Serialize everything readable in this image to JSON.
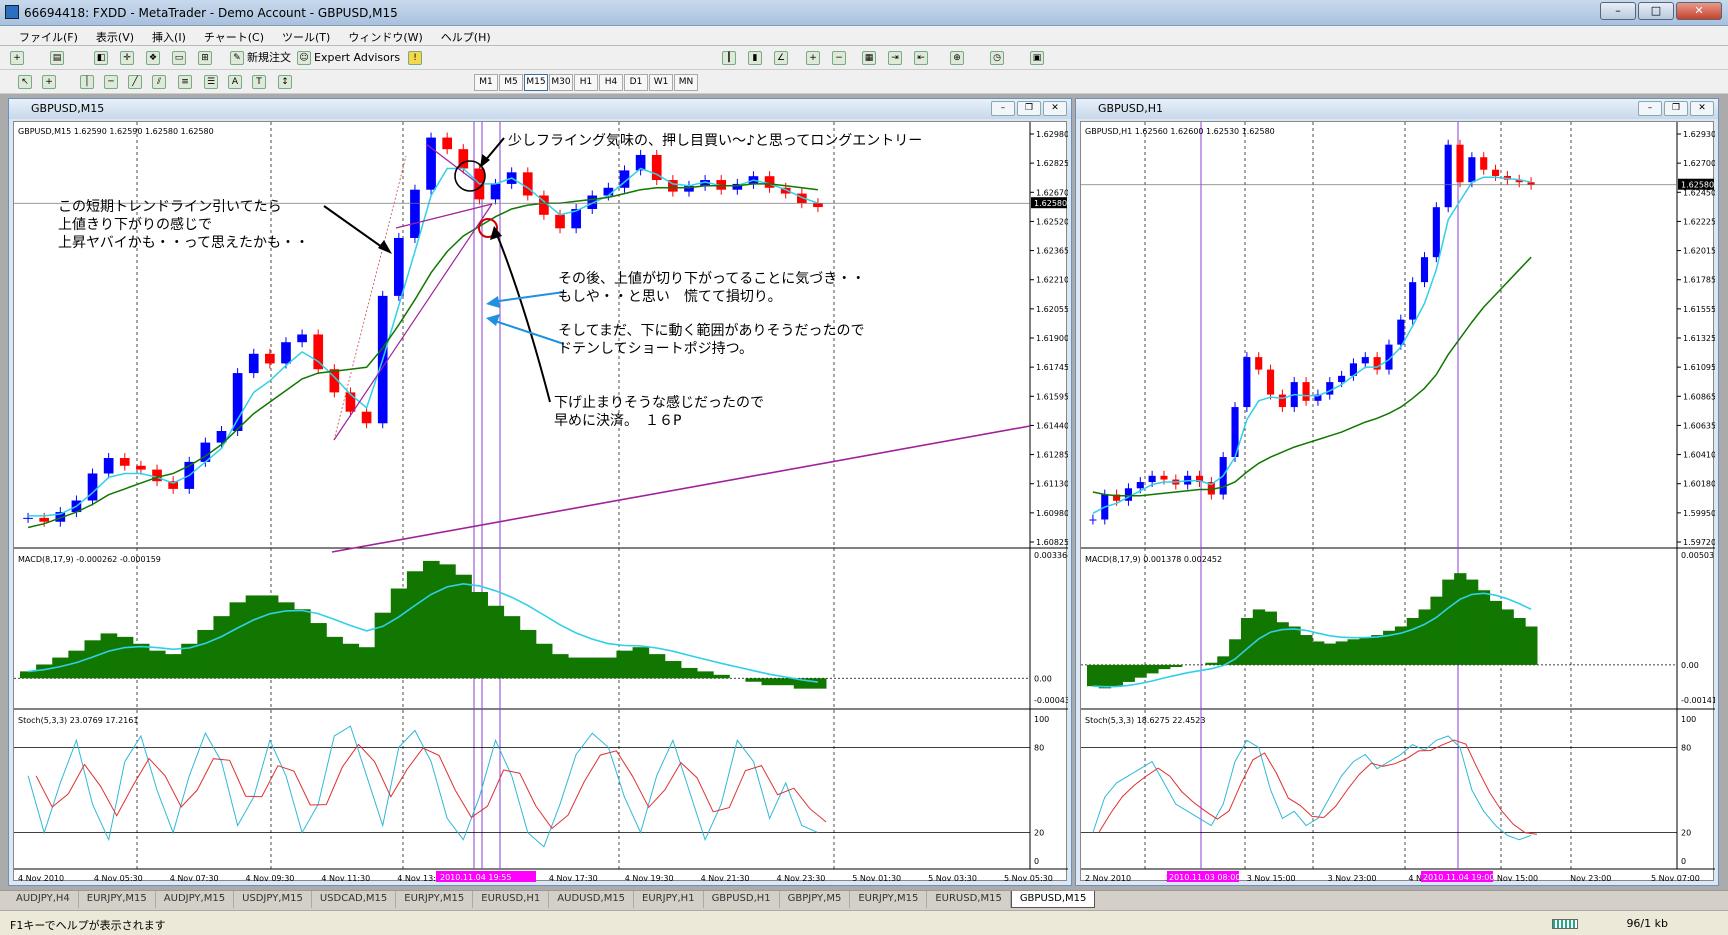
{
  "window": {
    "title": "66694418: FXDD - MetaTrader - Demo Account - GBPUSD,M15"
  },
  "menu": [
    "ファイル(F)",
    "表示(V)",
    "挿入(I)",
    "チャート(C)",
    "ツール(T)",
    "ウィンドウ(W)",
    "ヘルプ(H)"
  ],
  "toolbar": {
    "new_order": "新規注文",
    "expert_advisors": "Expert Advisors"
  },
  "timeframes": [
    "M1",
    "M5",
    "M15",
    "M30",
    "H1",
    "H4",
    "D1",
    "W1",
    "MN"
  ],
  "active_timeframe": "M15",
  "chart_left": {
    "title": "GBPUSD,M15",
    "info": "GBPUSD,M15  1.62590 1.62590 1.62580 1.62580",
    "current_price": "1.62580",
    "macd_label": "MACD(8,17,9) -0.000262 -0.000159",
    "macd_scale": [
      "0.003364",
      "0.00",
      "-0.00043"
    ],
    "stoch_label": "Stoch(5,3,3) 23.0769 17.2161",
    "stoch_scale": [
      "100",
      "80",
      "20",
      "0"
    ],
    "time_marker": "2010.11.04 19:55",
    "annotations": [
      "少しフライング気味の、押し目買い～♪と思ってロングエントリー",
      "この短期トレンドライン引いてたら",
      "上値きり下がりの感じで",
      "上昇ヤバイかも・・って思えたかも・・",
      "その後、上値が切り下がってることに気づき・・",
      "もしや・・と思い　慌てて損切り。",
      "そしてまだ、下に動く範囲がありそうだったので",
      "ドテンしてショートポジ持つ。",
      "下げ止まりそうな感じだったので",
      "早めに決済。　１６P"
    ]
  },
  "chart_right": {
    "title": "GBPUSD,H1",
    "info": "GBPUSD,H1  1.62560 1.62600 1.62530 1.62580",
    "current_price": "1.62580",
    "macd_label": "MACD(8,17,9) 0.001378 0.002452",
    "macd_scale": [
      "0.005031",
      "0.00",
      "-0.00141"
    ],
    "stoch_label": "Stoch(5,3,3) 18.6275 22.4523",
    "stoch_scale": [
      "100",
      "80",
      "20",
      "0"
    ],
    "time_marker_1": "2010.11.03 08:00",
    "time_marker_2": "2010.11.04 19:00"
  },
  "chart_data": [
    {
      "type": "candlestick",
      "title": "GBPUSD,M15",
      "ylim": [
        1.60825,
        1.6298
      ],
      "y_ticks": [
        "1.62980",
        "1.62825",
        "1.62670",
        "1.62520",
        "1.62365",
        "1.62210",
        "1.62055",
        "1.61900",
        "1.61745",
        "1.61595",
        "1.61440",
        "1.61285",
        "1.61130",
        "1.60980",
        "1.60825"
      ],
      "x_ticks": [
        "4 Nov 2010",
        "4 Nov 05:30",
        "4 Nov 07:30",
        "4 Nov 09:30",
        "4 Nov 11:30",
        "4 Nov 13:30",
        "4 Nov 15:30",
        "4 Nov 17:30",
        "4 Nov 19:30",
        "4 Nov 21:30",
        "4 Nov 23:30",
        "5 Nov 01:30",
        "5 Nov 03:30",
        "5 Nov 05:30"
      ],
      "close": [
        1.6095,
        1.6093,
        1.6098,
        1.6104,
        1.6118,
        1.6126,
        1.6122,
        1.612,
        1.6114,
        1.611,
        1.6124,
        1.6134,
        1.614,
        1.617,
        1.618,
        1.6175,
        1.6186,
        1.619,
        1.6172,
        1.616,
        1.615,
        1.6144,
        1.621,
        1.624,
        1.6265,
        1.6292,
        1.6286,
        1.6276,
        1.626,
        1.6268,
        1.6274,
        1.6262,
        1.6252,
        1.6245,
        1.6255,
        1.6262,
        1.6266,
        1.6275,
        1.6283,
        1.627,
        1.6264,
        1.6267,
        1.627,
        1.6265,
        1.6268,
        1.6272,
        1.6266,
        1.6263,
        1.6258,
        1.6256
      ],
      "series": [
        {
          "values": [
            1.6096,
            1.6096,
            1.6097,
            1.6101,
            1.6108,
            1.6116,
            1.6118,
            1.6118,
            1.6116,
            1.6113,
            1.6117,
            1.6124,
            1.6131,
            1.6146,
            1.616,
            1.6166,
            1.6174,
            1.6181,
            1.6176,
            1.6168,
            1.6159,
            1.6152,
            1.6177,
            1.6205,
            1.6233,
            1.6262,
            1.6276,
            1.6276,
            1.6268,
            1.6268,
            1.6271,
            1.6266,
            1.6259,
            1.6252,
            1.6254,
            1.6258,
            1.6262,
            1.6269,
            1.6276,
            1.6273,
            1.6268,
            1.6267,
            1.6269,
            1.6267,
            1.6267,
            1.627,
            1.6268,
            1.6265,
            1.6261,
            1.6258
          ]
        },
        {
          "values": [
            1.609,
            1.6092,
            1.6095,
            1.6098,
            1.6102,
            1.6107,
            1.611,
            1.6113,
            1.6116,
            1.6118,
            1.6122,
            1.6127,
            1.6133,
            1.6141,
            1.6149,
            1.6155,
            1.6161,
            1.6167,
            1.617,
            1.6171,
            1.6172,
            1.6173,
            1.6183,
            1.6195,
            1.6208,
            1.6222,
            1.6233,
            1.6241,
            1.6246,
            1.6251,
            1.6255,
            1.6257,
            1.6258,
            1.6258,
            1.6259,
            1.626,
            1.6261,
            1.6263,
            1.6265,
            1.6266,
            1.6266,
            1.6266,
            1.6267,
            1.6267,
            1.6267,
            1.6268,
            1.6268,
            1.6267,
            1.6266,
            1.6265
          ]
        }
      ],
      "macd": [
        0.0002,
        0.0004,
        0.0006,
        0.0008,
        0.0011,
        0.0013,
        0.0012,
        0.001,
        0.0008,
        0.0007,
        0.001,
        0.0014,
        0.0018,
        0.0022,
        0.0024,
        0.0024,
        0.0022,
        0.002,
        0.0016,
        0.0012,
        0.001,
        0.0009,
        0.0019,
        0.0026,
        0.0031,
        0.0034,
        0.0033,
        0.003,
        0.0025,
        0.0021,
        0.0018,
        0.0014,
        0.001,
        0.0007,
        0.0006,
        0.0006,
        0.0006,
        0.0008,
        0.0009,
        0.0007,
        0.0005,
        0.0003,
        0.0002,
        0.0001,
        0.0,
        -0.0001,
        -0.0002,
        -0.0002,
        -0.0003,
        -0.0003
      ],
      "stoch": [
        60,
        20,
        55,
        85,
        40,
        15,
        70,
        88,
        50,
        20,
        60,
        90,
        70,
        25,
        45,
        85,
        60,
        20,
        40,
        88,
        95,
        60,
        25,
        80,
        92,
        70,
        30,
        15,
        45,
        85,
        60,
        20,
        10,
        40,
        75,
        90,
        80,
        45,
        20,
        60,
        85,
        50,
        15,
        40,
        85,
        70,
        30,
        55,
        25,
        20
      ]
    },
    {
      "type": "candlestick",
      "title": "GBPUSD,H1",
      "ylim": [
        1.5972,
        1.6305
      ],
      "y_ticks": [
        "1.62930",
        "1.62700",
        "1.62450",
        "1.62225",
        "1.62015",
        "1.61785",
        "1.61555",
        "1.61325",
        "1.61095",
        "1.60865",
        "1.60635",
        "1.60410",
        "1.60180",
        "1.59950",
        "1.59720"
      ],
      "x_ticks": [
        "2 Nov 2010",
        "2 Nov",
        "3 Nov 15:00",
        "3 Nov 23:00",
        "4 Nov 07:00",
        "4 Nov 15:00",
        "Nov 23:00",
        "5 Nov 07:00"
      ],
      "close": [
        1.599,
        1.601,
        1.6005,
        1.6015,
        1.602,
        1.6025,
        1.6022,
        1.6018,
        1.6025,
        1.602,
        1.601,
        1.604,
        1.608,
        1.612,
        1.611,
        1.609,
        1.608,
        1.61,
        1.6085,
        1.609,
        1.61,
        1.6105,
        1.6115,
        1.612,
        1.611,
        1.613,
        1.615,
        1.618,
        1.62,
        1.624,
        1.629,
        1.626,
        1.628,
        1.627,
        1.6265,
        1.6262,
        1.626,
        1.6258
      ],
      "series": [
        {
          "values": [
            1.5995,
            1.6,
            1.6003,
            1.6008,
            1.6013,
            1.6018,
            1.602,
            1.602,
            1.6021,
            1.6021,
            1.6018,
            1.6025,
            1.604,
            1.607,
            1.6085,
            1.6088,
            1.6087,
            1.609,
            1.6089,
            1.6089,
            1.6093,
            1.6098,
            1.6105,
            1.6112,
            1.6112,
            1.6118,
            1.6128,
            1.6145,
            1.6163,
            1.619,
            1.623,
            1.6245,
            1.626,
            1.6264,
            1.6264,
            1.6263,
            1.6262,
            1.626
          ]
        },
        {
          "values": [
            1.6012,
            1.601,
            1.6009,
            1.6009,
            1.6009,
            1.601,
            1.6011,
            1.6012,
            1.6013,
            1.6014,
            1.6014,
            1.6016,
            1.602,
            1.6028,
            1.6035,
            1.604,
            1.6044,
            1.6048,
            1.6051,
            1.6054,
            1.6057,
            1.606,
            1.6064,
            1.6068,
            1.6071,
            1.6075,
            1.608,
            1.6087,
            1.6095,
            1.6106,
            1.6122,
            1.6135,
            1.6148,
            1.616,
            1.617,
            1.618,
            1.619,
            1.62
          ]
        }
      ],
      "macd": [
        -0.001,
        -0.0011,
        -0.001,
        -0.0008,
        -0.0006,
        -0.0004,
        -0.0002,
        -0.0001,
        0.0,
        0.0,
        0.0001,
        0.0004,
        0.0012,
        0.0022,
        0.0026,
        0.0025,
        0.002,
        0.0018,
        0.0014,
        0.0011,
        0.001,
        0.0011,
        0.0012,
        0.0013,
        0.0014,
        0.0016,
        0.0018,
        0.0022,
        0.0026,
        0.0032,
        0.004,
        0.0043,
        0.004,
        0.0035,
        0.003,
        0.0026,
        0.0022,
        0.0018
      ],
      "stoch": [
        20,
        45,
        55,
        60,
        65,
        70,
        55,
        40,
        35,
        30,
        25,
        40,
        70,
        85,
        80,
        50,
        30,
        35,
        25,
        30,
        45,
        60,
        70,
        75,
        65,
        70,
        75,
        82,
        78,
        85,
        88,
        80,
        50,
        35,
        25,
        18,
        15,
        18
      ]
    }
  ]
}
